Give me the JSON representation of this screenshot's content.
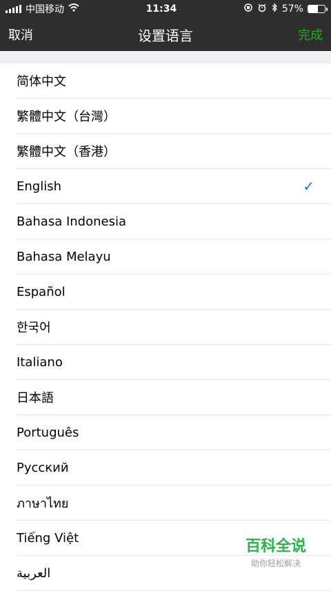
{
  "status_bar": {
    "carrier": "中国移动",
    "time": "11:34",
    "battery_percent_label": "57%",
    "battery_level": 0.57,
    "icons": [
      "signal-icon",
      "wifi-icon",
      "screen-lock-rotation-icon",
      "alarm-icon",
      "bluetooth-icon",
      "battery-icon"
    ]
  },
  "nav": {
    "cancel_label": "取消",
    "title": "设置语言",
    "done_label": "完成"
  },
  "languages": [
    {
      "label": "简体中文"
    },
    {
      "label": "繁體中文（台灣）"
    },
    {
      "label": "繁體中文（香港）"
    },
    {
      "label": "English",
      "selected": true
    },
    {
      "label": "Bahasa Indonesia"
    },
    {
      "label": "Bahasa Melayu"
    },
    {
      "label": "Español"
    },
    {
      "label": "한국어"
    },
    {
      "label": "Italiano"
    },
    {
      "label": "日本語"
    },
    {
      "label": "Português"
    },
    {
      "label": "Русский"
    },
    {
      "label": "ภาษาไทย"
    },
    {
      "label": "Tiếng Việt"
    },
    {
      "label": "العربية"
    }
  ],
  "check_mark": "✓",
  "watermark": {
    "main": "百科全说",
    "sub": "助你轻松解决"
  },
  "colors": {
    "nav_bg": "#2e2e2e",
    "done_green": "#1aad19",
    "check_blue": "#1a73e8"
  }
}
